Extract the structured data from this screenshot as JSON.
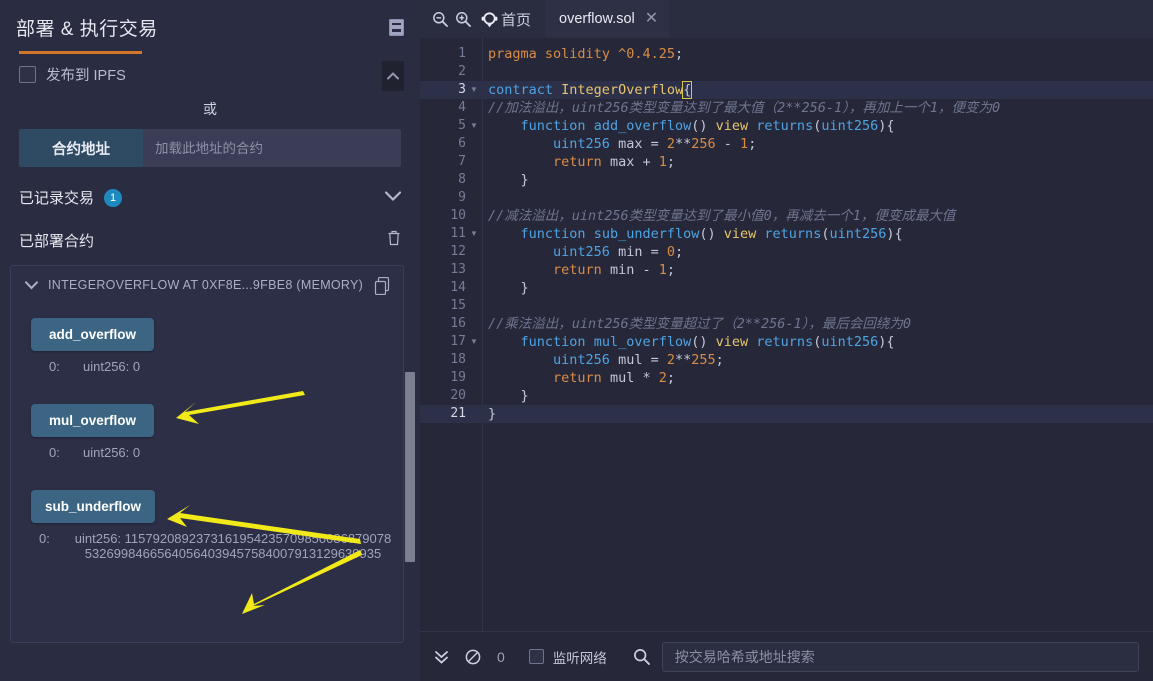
{
  "left_panel": {
    "title": "部署 & 执行交易",
    "doc_icon": "document-icon",
    "publish_ipfs_label": "发布到 IPFS",
    "or_label": "或",
    "at_address_button": "合约地址",
    "at_address_placeholder": "加载此地址的合约",
    "recorded_tx_label": "已记录交易",
    "recorded_tx_count": "1",
    "deployed_label": "已部署合约",
    "contract": {
      "header": "INTEGEROVERFLOW AT 0XF8E...9FBE8 (MEMORY)",
      "functions": [
        {
          "name": "add_overflow",
          "result_index": "0:",
          "result_value": "uint256: 0"
        },
        {
          "name": "mul_overflow",
          "result_index": "0:",
          "result_value": "uint256: 0"
        },
        {
          "name": "sub_underflow",
          "result_index": "0:",
          "result_value": "uint256: 115792089237316195423570985008687907853269984665640564039457584007913129639935"
        }
      ]
    }
  },
  "editor": {
    "zoom_out_icon": "zoom-out-icon",
    "zoom_in_icon": "zoom-in-icon",
    "home_icon": "remix-home-icon",
    "home_label": "首页",
    "tab_name": "overflow.sol",
    "tab_close": "✕",
    "lines": [
      {
        "n": "1",
        "fold": false,
        "active": false,
        "html": "<span class='kw2'>pragma</span> <span class='kw2'>solidity</span> <span class='str'>^0.4.25</span><span class='pun'>;</span>"
      },
      {
        "n": "2",
        "fold": false,
        "active": false,
        "html": ""
      },
      {
        "n": "3",
        "fold": true,
        "active": true,
        "html": "<span class='kw'>contract</span> <span class='typ'>IntegerOverflow</span><span class='pun bracket-hl'>{</span><span class='cursor'></span>"
      },
      {
        "n": "4",
        "fold": false,
        "active": false,
        "html": "<span class='cmt'>//加法溢出，uint256类型变量达到了最大值（2**256-1），再加上一个1，便变为0</span>"
      },
      {
        "n": "5",
        "fold": true,
        "active": false,
        "html": "    <span class='kw'>function</span> <span class='fn'>add_overflow</span><span class='pun'>()</span> <span class='typ'>view</span> <span class='kw'>returns</span><span class='pun'>(</span><span class='kw'>uint256</span><span class='pun'>){</span>"
      },
      {
        "n": "6",
        "fold": false,
        "active": false,
        "html": "        <span class='kw'>uint256</span> <span class='pun'>max = </span><span class='num'>2</span><span class='pun'>**</span><span class='num'>256</span><span class='pun'> - </span><span class='num'>1</span><span class='pun'>;</span>"
      },
      {
        "n": "7",
        "fold": false,
        "active": false,
        "html": "        <span class='kw2'>return</span><span class='pun'> max + </span><span class='num'>1</span><span class='pun'>;</span>"
      },
      {
        "n": "8",
        "fold": false,
        "active": false,
        "html": "    <span class='pun'>}</span>"
      },
      {
        "n": "9",
        "fold": false,
        "active": false,
        "html": ""
      },
      {
        "n": "10",
        "fold": false,
        "active": false,
        "html": "<span class='cmt'>//减法溢出，uint256类型变量达到了最小值0，再减去一个1，便变成最大值</span>"
      },
      {
        "n": "11",
        "fold": true,
        "active": false,
        "html": "    <span class='kw'>function</span> <span class='fn'>sub_underflow</span><span class='pun'>()</span> <span class='typ'>view</span> <span class='kw'>returns</span><span class='pun'>(</span><span class='kw'>uint256</span><span class='pun'>){</span>"
      },
      {
        "n": "12",
        "fold": false,
        "active": false,
        "html": "        <span class='kw'>uint256</span> <span class='pun'>min = </span><span class='num'>0</span><span class='pun'>;</span>"
      },
      {
        "n": "13",
        "fold": false,
        "active": false,
        "html": "        <span class='kw2'>return</span><span class='pun'> min - </span><span class='num'>1</span><span class='pun'>;</span>"
      },
      {
        "n": "14",
        "fold": false,
        "active": false,
        "html": "    <span class='pun'>}</span>"
      },
      {
        "n": "15",
        "fold": false,
        "active": false,
        "html": ""
      },
      {
        "n": "16",
        "fold": false,
        "active": false,
        "html": "<span class='cmt'>//乘法溢出，uint256类型变量超过了（2**256-1），最后会回绕为0</span>"
      },
      {
        "n": "17",
        "fold": true,
        "active": false,
        "html": "    <span class='kw'>function</span> <span class='fn'>mul_overflow</span><span class='pun'>()</span> <span class='typ'>view</span> <span class='kw'>returns</span><span class='pun'>(</span><span class='kw'>uint256</span><span class='pun'>){</span>"
      },
      {
        "n": "18",
        "fold": false,
        "active": false,
        "html": "        <span class='kw'>uint256</span> <span class='pun'>mul = </span><span class='num'>2</span><span class='pun'>**</span><span class='num'>255</span><span class='pun'>;</span>"
      },
      {
        "n": "19",
        "fold": false,
        "active": false,
        "html": "        <span class='kw2'>return</span><span class='pun'> mul * </span><span class='num'>2</span><span class='pun'>;</span>"
      },
      {
        "n": "20",
        "fold": false,
        "active": false,
        "html": "    <span class='pun'>}</span>"
      },
      {
        "n": "21",
        "fold": false,
        "active": true,
        "html": "<span class='pun'>}</span>"
      }
    ]
  },
  "terminal": {
    "collapse_icon": "double-chevron-down-icon",
    "clear_icon": "no-entry-icon",
    "count": "0",
    "listen_label": "监听网络",
    "search_icon": "search-icon",
    "search_placeholder": "按交易哈希或地址搜索"
  },
  "colors": {
    "accent_orange": "#d4762a",
    "badge_blue": "#1f8ac0",
    "button_blue": "#3b6582",
    "arrow_yellow": "#f2ea18",
    "panel_bg": "#2a2c42",
    "editor_bg": "#262839"
  }
}
